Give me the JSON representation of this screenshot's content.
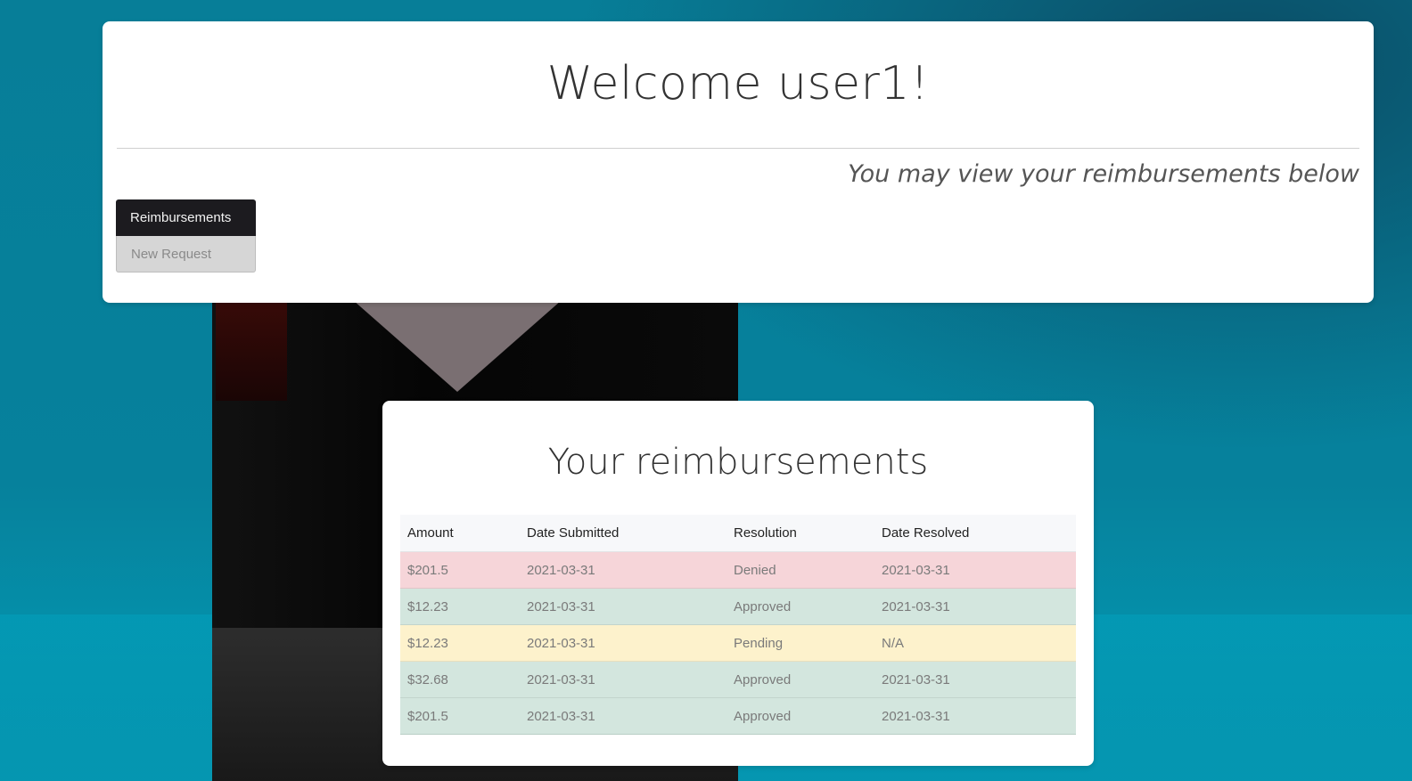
{
  "header": {
    "welcome": "Welcome user1!",
    "subtitle": "You may view your reimbursements below"
  },
  "nav": {
    "tabs": [
      {
        "label": "Reimbursements",
        "active": true
      },
      {
        "label": "New Request",
        "active": false
      }
    ]
  },
  "reimbursements": {
    "title": "Your reimbursements",
    "columns": [
      "Amount",
      "Date Submitted",
      "Resolution",
      "Date Resolved"
    ],
    "rows": [
      {
        "amount": "$201.5",
        "date_submitted": "2021-03-31",
        "resolution": "Denied",
        "date_resolved": "2021-03-31",
        "status": "denied"
      },
      {
        "amount": "$12.23",
        "date_submitted": "2021-03-31",
        "resolution": "Approved",
        "date_resolved": "2021-03-31",
        "status": "approved"
      },
      {
        "amount": "$12.23",
        "date_submitted": "2021-03-31",
        "resolution": "Pending",
        "date_resolved": "N/A",
        "status": "pending"
      },
      {
        "amount": "$32.68",
        "date_submitted": "2021-03-31",
        "resolution": "Approved",
        "date_resolved": "2021-03-31",
        "status": "approved"
      },
      {
        "amount": "$201.5",
        "date_submitted": "2021-03-31",
        "resolution": "Approved",
        "date_resolved": "2021-03-31",
        "status": "approved"
      }
    ]
  },
  "colors": {
    "denied_row": "#f6d5d9",
    "approved_row": "#d3e6de",
    "pending_row": "#fdf2cc",
    "active_tab": "#1c1b1f",
    "inactive_tab": "#d6d6d6",
    "background": "#077e98"
  }
}
